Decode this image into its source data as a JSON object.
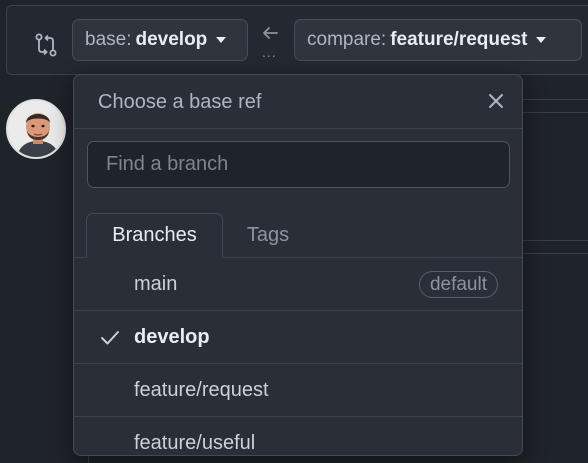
{
  "compare_bar": {
    "base_prefix": "base:",
    "base_value": "develop",
    "compare_prefix": "compare:",
    "compare_value": "feature/request",
    "arrow_dots": "..."
  },
  "dropdown": {
    "title": "Choose a base ref",
    "search_placeholder": "Find a branch",
    "tabs": [
      {
        "label": "Branches",
        "active": true
      },
      {
        "label": "Tags",
        "active": false
      }
    ],
    "branches": [
      {
        "name": "main",
        "badge": "default",
        "selected": false
      },
      {
        "name": "develop",
        "badge": "",
        "selected": true
      },
      {
        "name": "feature/request",
        "badge": "",
        "selected": false
      },
      {
        "name": "feature/useful",
        "badge": "",
        "selected": false
      }
    ]
  },
  "colors": {
    "background": "#1f232a",
    "panel": "#2a2e36",
    "border": "#444a53",
    "text_primary": "#e6edf3",
    "text_muted": "#8b949e"
  }
}
